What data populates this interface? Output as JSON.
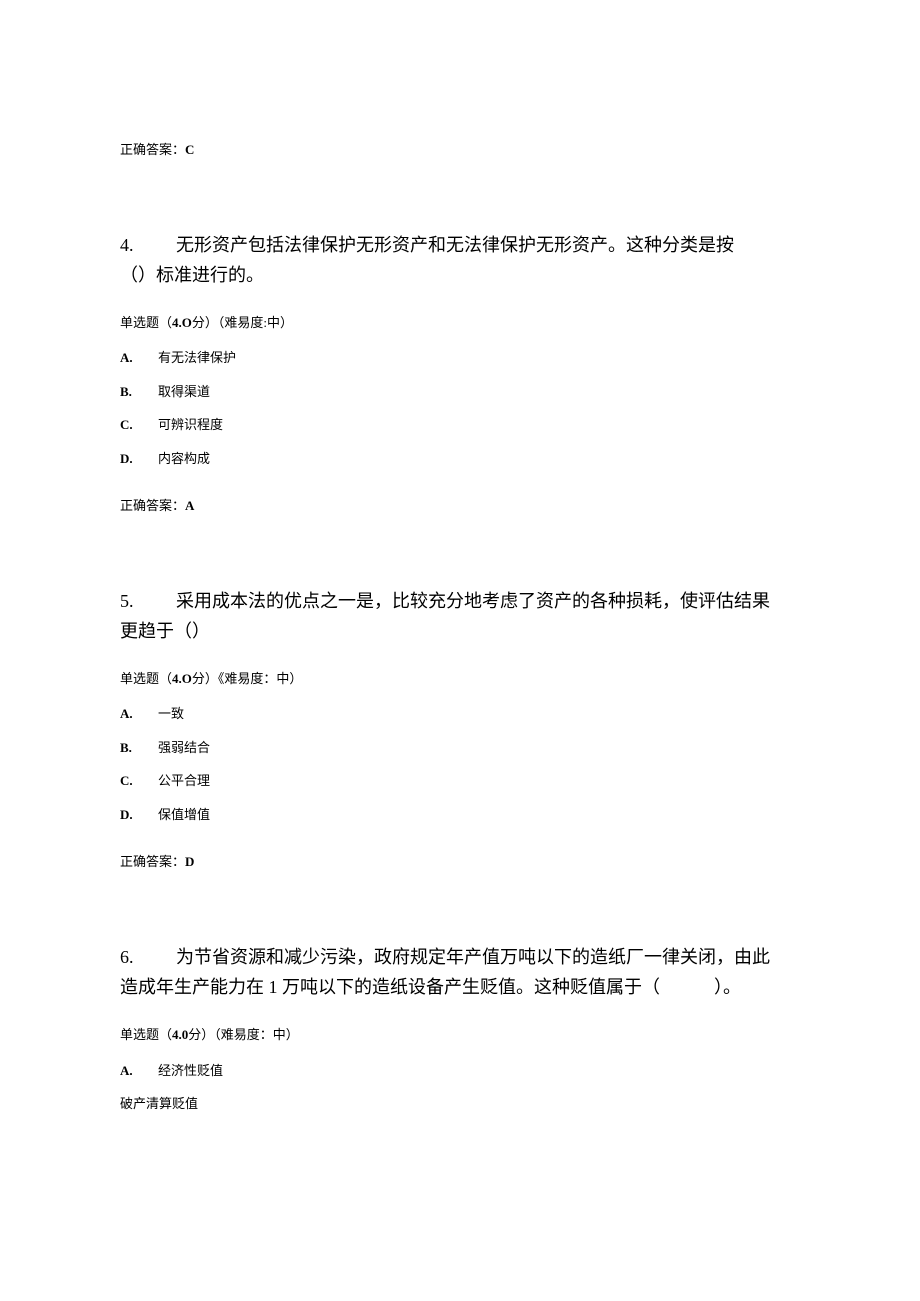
{
  "prev_answer": {
    "label": "正确答案：",
    "value": "C"
  },
  "q4": {
    "number": "4.",
    "stem_line1": "无形资产包括法律保护无形资产和无法律保护无形资产。这种分类是按",
    "stem_line2": "（）标准进行的。",
    "meta_prefix": "单选题（",
    "meta_points": "4.O",
    "meta_mid": "分）（难易度:中）",
    "options": [
      {
        "letter": "A.",
        "text": "有无法律保护"
      },
      {
        "letter": "B.",
        "text": "取得渠道"
      },
      {
        "letter": "C.",
        "text": " 可辨识程度"
      },
      {
        "letter": "D.",
        "text": "内容构成"
      }
    ],
    "answer_label": "正确答案：",
    "answer_value": "A"
  },
  "q5": {
    "number": "5.",
    "stem_line1": "采用成本法的优点之一是，比较充分地考虑了资产的各种损耗，使评估结果",
    "stem_line2": "更趋于（）",
    "meta_prefix": "单选题（",
    "meta_points": "4.O",
    "meta_mid": "分）《难易度：中）",
    "options": [
      {
        "letter": "A.",
        "text": " 一致"
      },
      {
        "letter": "B.",
        "text": "强弱结合"
      },
      {
        "letter": "C.",
        "text": "公平合理"
      },
      {
        "letter": "D.",
        "text": "保值增值"
      }
    ],
    "answer_label": "正确答案：",
    "answer_value": "D"
  },
  "q6": {
    "number": "6.",
    "stem_line1": "为节省资源和减少污染，政府规定年产值万吨以下的造纸厂一律关闭，由此",
    "stem_line2": "造成年生产能力在 1 万吨以下的造纸设备产生贬值。这种贬值属于（　　　）。",
    "meta_prefix": "单选题（",
    "meta_points": "4.0",
    "meta_mid": "分）（难易度：中）",
    "options": [
      {
        "letter": "A.",
        "text": " 经济性贬值"
      }
    ],
    "trailing": "破产清算贬值"
  }
}
